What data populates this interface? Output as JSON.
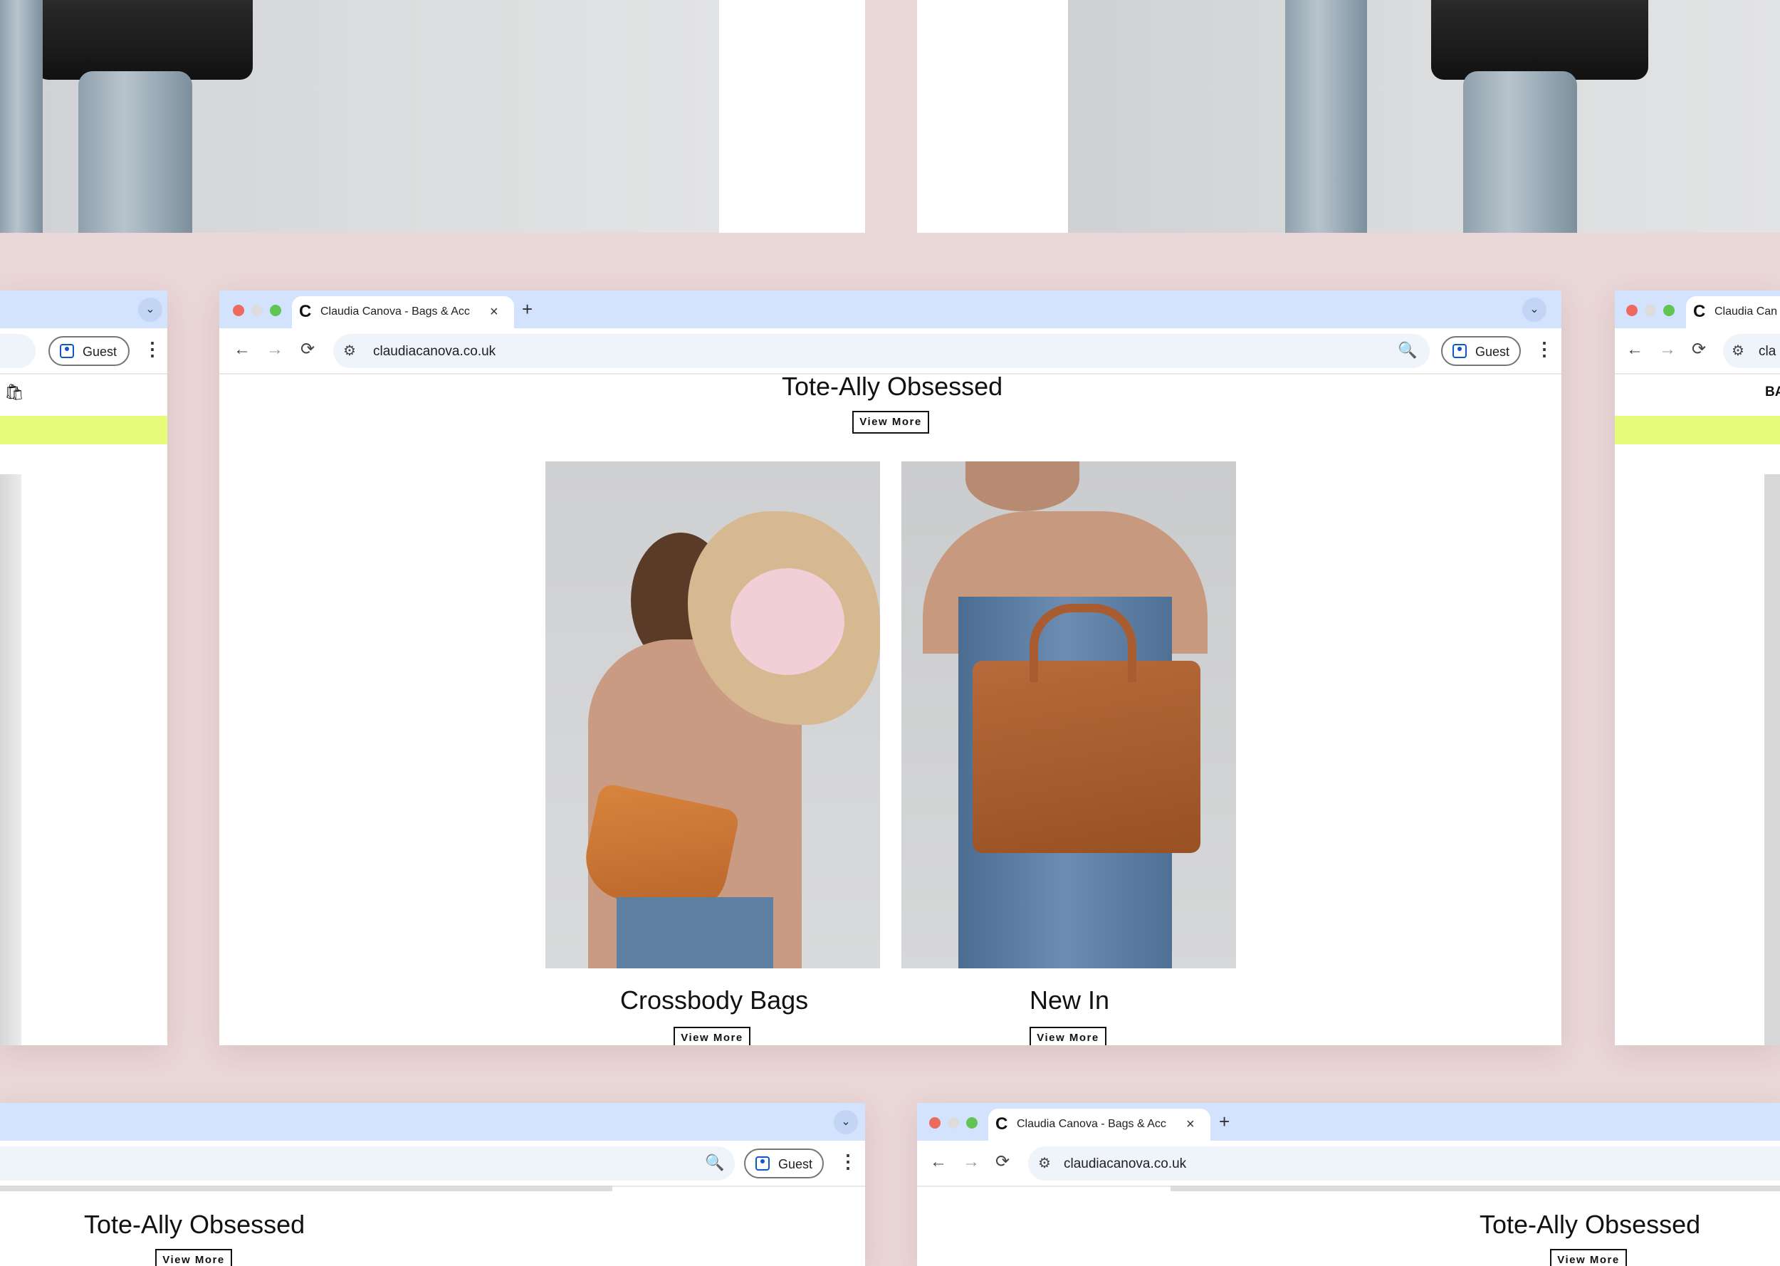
{
  "browser": {
    "tab_title": "Claudia Canova - Bags & Acc",
    "tab_title_short": "Claudia Can",
    "url": "claudiacanova.co.uk",
    "url_short": "cla",
    "guest_label": "Guest",
    "favicon_letter": "C"
  },
  "icons": {
    "close": "×",
    "new_tab": "+",
    "tab_menu": "⌄",
    "back": "←",
    "forward": "→",
    "reload": "⟳",
    "site_info": "⚙",
    "zoom": "🔍",
    "menu": "⋮",
    "bag": "🛍"
  },
  "main_page": {
    "top_section": {
      "title": "Tote-Ally Obsessed",
      "cta": "View More"
    },
    "cards": [
      {
        "title": "Crossbody Bags",
        "cta": "View More"
      },
      {
        "title": "New In",
        "cta": "View More"
      }
    ]
  },
  "side_pages": {
    "right_partial_nav": "BA",
    "bottom_left": {
      "title": "Tote-Ally Obsessed",
      "cta": "View More"
    },
    "bottom_right": {
      "title": "Tote-Ally Obsessed",
      "cta": "View More"
    }
  },
  "colors": {
    "background": "#ead7d7",
    "tabstrip": "#d3e3fd",
    "accent_lime": "#e8fc7c",
    "traffic_red": "#ed6a5e",
    "traffic_yellow": "#dcdcdc",
    "traffic_green": "#61c554"
  }
}
